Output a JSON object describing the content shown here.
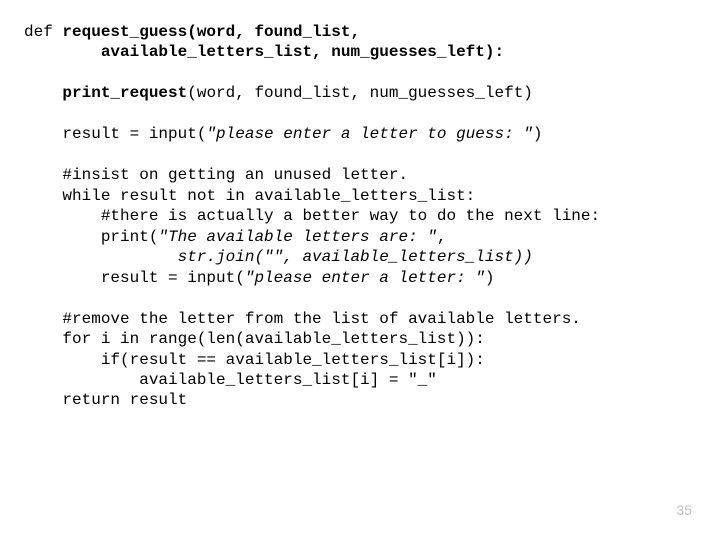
{
  "code": {
    "l1a": "def ",
    "l1b": "request_guess(word, found_list,",
    "l2": "        available_letters_list, num_guesses_left):",
    "l3": "",
    "l4a": "    ",
    "l4b": "print_request",
    "l4c": "(word, found_list, num_guesses_left)",
    "l5": "",
    "l6a": "    result = input(",
    "l6b": "\"please enter a letter to guess: \"",
    "l6c": ")",
    "l7": "",
    "l8": "    #insist on getting an unused letter.",
    "l9": "    while result not in available_letters_list:",
    "l10": "        #there is actually a better way to do the next line:",
    "l11a": "        print(",
    "l11b": "\"The available letters are: \"",
    "l11c": ",",
    "l12a": "                ",
    "l12b": "str.join(\"\", available_letters_list))",
    "l13a": "        result = input(",
    "l13b": "\"please enter a letter: \"",
    "l13c": ")",
    "l14": "",
    "l15": "    #remove the letter from the list of available letters.",
    "l16": "    for i in range(len(available_letters_list)):",
    "l17": "        if(result == available_letters_list[i]):",
    "l18": "            available_letters_list[i] = \"_\"",
    "l19": "    return result"
  },
  "page_number": "35"
}
